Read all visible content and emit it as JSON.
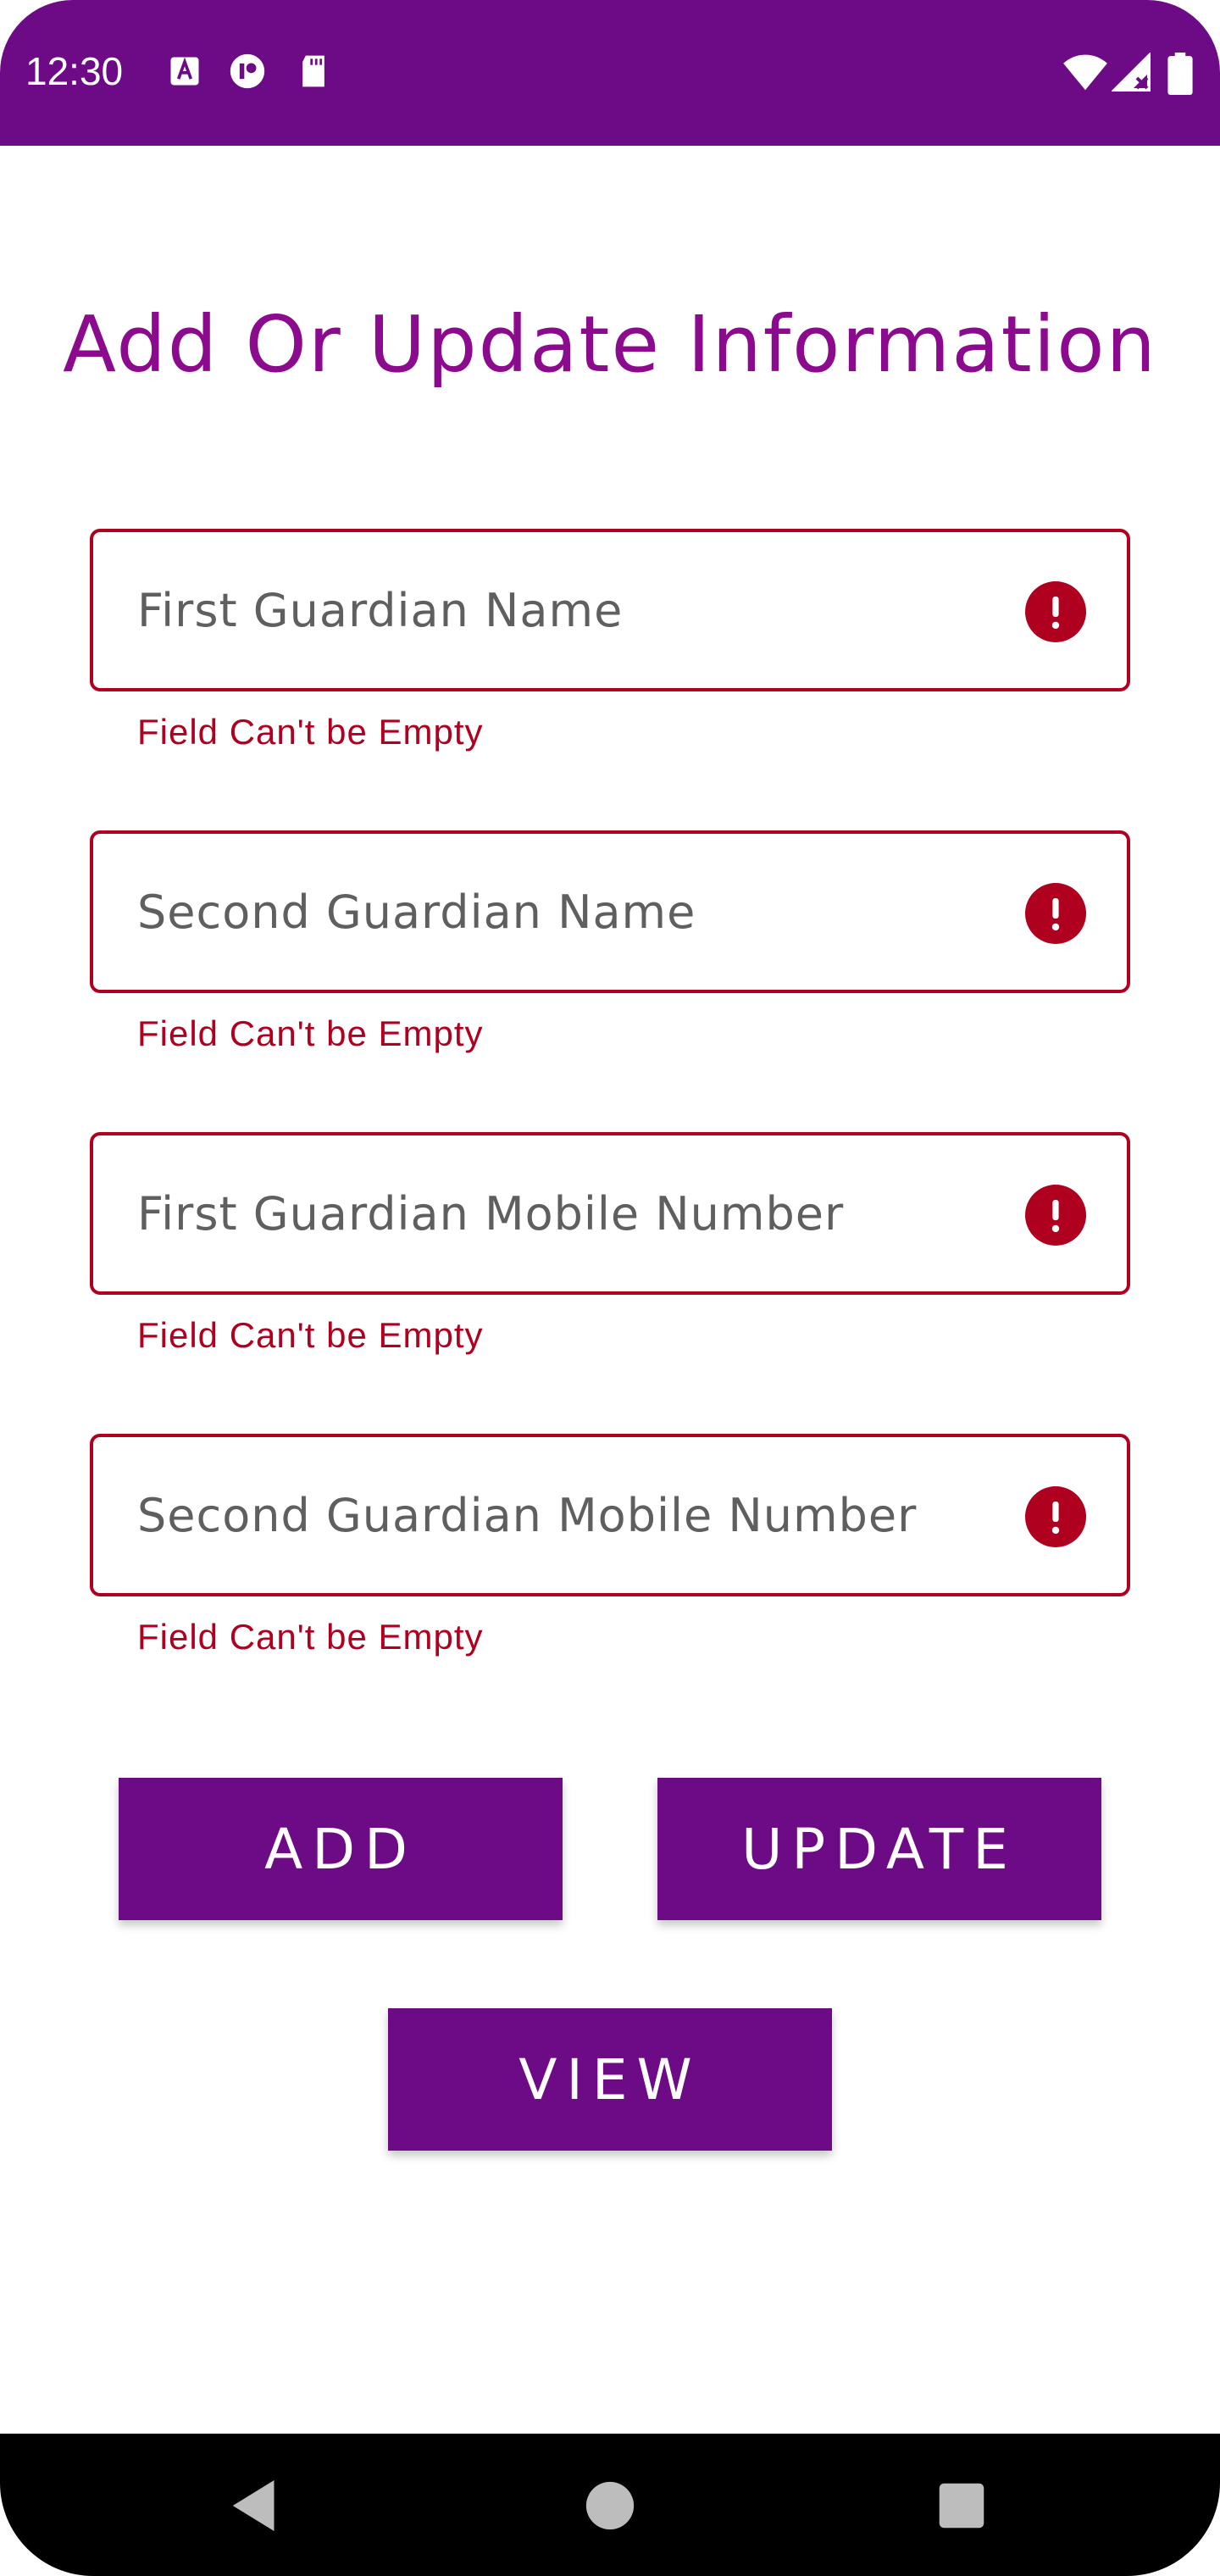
{
  "status_bar": {
    "time": "12:30",
    "left_icons": [
      "font-a-icon",
      "app-circle-icon",
      "sd-card-icon"
    ],
    "right_icons": [
      "wifi-icon",
      "signal-icon",
      "battery-icon"
    ],
    "background": "#6d0b86"
  },
  "title": "Add Or Update Information",
  "fields": [
    {
      "placeholder": "First Guardian Name",
      "value": "",
      "error": "Field Can't be Empty",
      "icon": "error-icon"
    },
    {
      "placeholder": "Second Guardian Name",
      "value": "",
      "error": "Field Can't be Empty",
      "icon": "error-icon"
    },
    {
      "placeholder": "First Guardian Mobile Number",
      "value": "",
      "error": "Field Can't be Empty",
      "icon": "error-icon"
    },
    {
      "placeholder": "Second Guardian Mobile Number",
      "value": "",
      "error": "Field Can't be Empty",
      "icon": "error-icon"
    }
  ],
  "buttons": {
    "add": "ADD",
    "update": "UPDATE",
    "view": "VIEW"
  },
  "nav_bar": {
    "buttons": [
      "back-icon",
      "home-icon",
      "recents-icon"
    ]
  },
  "colors": {
    "primary": "#6d0b86",
    "title": "#8b0a8d",
    "error": "#b00020",
    "hint_text": "#5f5f5f"
  }
}
